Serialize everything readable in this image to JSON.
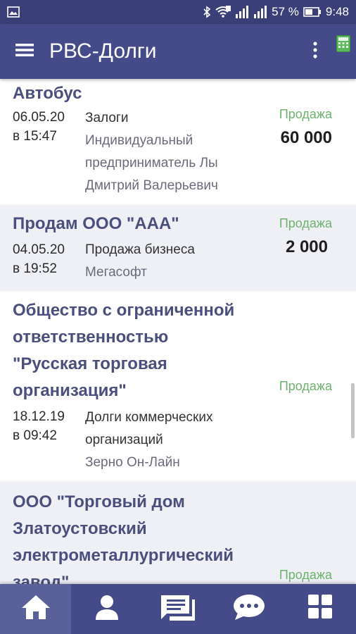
{
  "status_bar": {
    "battery": "57 %",
    "time": "9:48",
    "icons": [
      "gallery-icon",
      "bluetooth-icon",
      "wifi-icon",
      "signal-icon",
      "battery-icon"
    ]
  },
  "app_bar": {
    "title": "РВС-Долги",
    "icons": [
      "menu-icon",
      "more-vert-icon",
      "calculator-icon"
    ]
  },
  "listings": [
    {
      "title": "Автобус",
      "date": "06.05.20",
      "time": "в 15:47",
      "category": "Залоги",
      "seller_lines": [
        "Индивидуальный",
        "предприниматель Лы",
        "Дмитрий Валерьевич"
      ],
      "deal_type": "Продажа",
      "price": "60 000"
    },
    {
      "title": "Продам ООО \"ААА\"",
      "date": "04.05.20",
      "time": "в 19:52",
      "category": "Продажа бизнеса",
      "seller_lines": [
        "Мегасофт"
      ],
      "deal_type": "Продажа",
      "price": "2 000"
    },
    {
      "title_lines": [
        "Общество с ограниченной",
        "ответственностью",
        "\"Русская торговая",
        "организация\""
      ],
      "date": "18.12.19",
      "time": "в 09:42",
      "category_lines": [
        "Долги коммерческих",
        "организаций"
      ],
      "seller_lines": [
        "Зерно Он-Лайн"
      ],
      "deal_type": "Продажа"
    },
    {
      "title_lines": [
        "ООО \"Торговый дом",
        "Златоустовский",
        "электрометаллургический",
        "завод\""
      ],
      "deal_type": "Продажа"
    }
  ],
  "bottom_nav": {
    "items": [
      "home-icon",
      "person-icon",
      "messages-list-icon",
      "chat-icon",
      "dashboard-icon"
    ],
    "active": "home-icon"
  },
  "colors": {
    "status_bar": "#3a3f78",
    "app_bar": "#454b88",
    "title": "#4a4f7e",
    "deal_type": "#6db26d"
  }
}
